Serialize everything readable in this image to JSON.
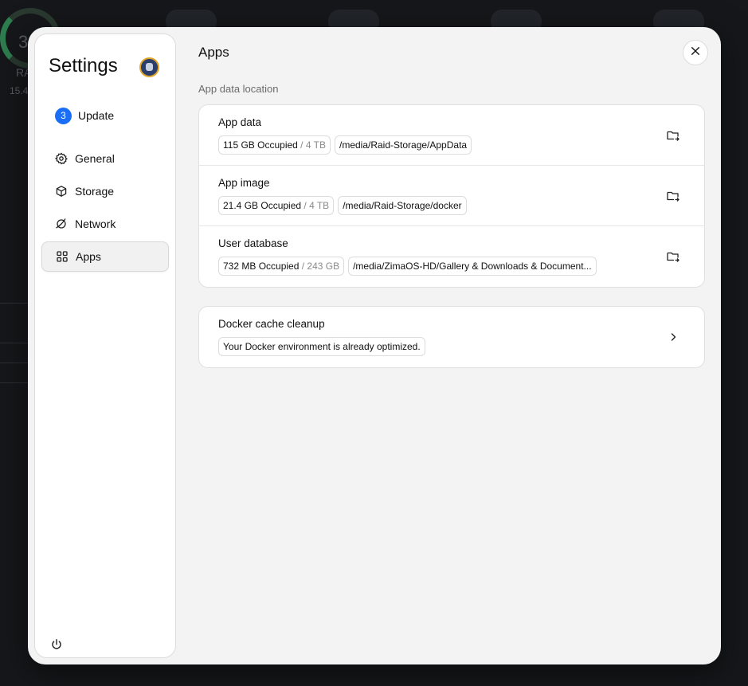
{
  "sidebar": {
    "title": "Settings",
    "update": {
      "count": "3",
      "label": "Update"
    },
    "items": [
      {
        "label": "General"
      },
      {
        "label": "Storage"
      },
      {
        "label": "Network"
      },
      {
        "label": "Apps"
      }
    ]
  },
  "main": {
    "title": "Apps",
    "section_label": "App data location",
    "locations": [
      {
        "title": "App data",
        "occupied": "115 GB Occupied",
        "total": " / 4 TB",
        "path": "/media/Raid-Storage/AppData"
      },
      {
        "title": "App image",
        "occupied": "21.4 GB Occupied",
        "total": " / 4 TB",
        "path": "/media/Raid-Storage/docker"
      },
      {
        "title": "User database",
        "occupied": "732 MB Occupied",
        "total": " / 243 GB",
        "path": "/media/ZimaOS-HD/Gallery & Downloads & Document..."
      }
    ],
    "docker": {
      "title": "Docker cache cleanup",
      "status": "Your Docker environment is already optimized."
    }
  },
  "background": {
    "gauge_value": "3",
    "label": "RA",
    "value": "15.4"
  }
}
